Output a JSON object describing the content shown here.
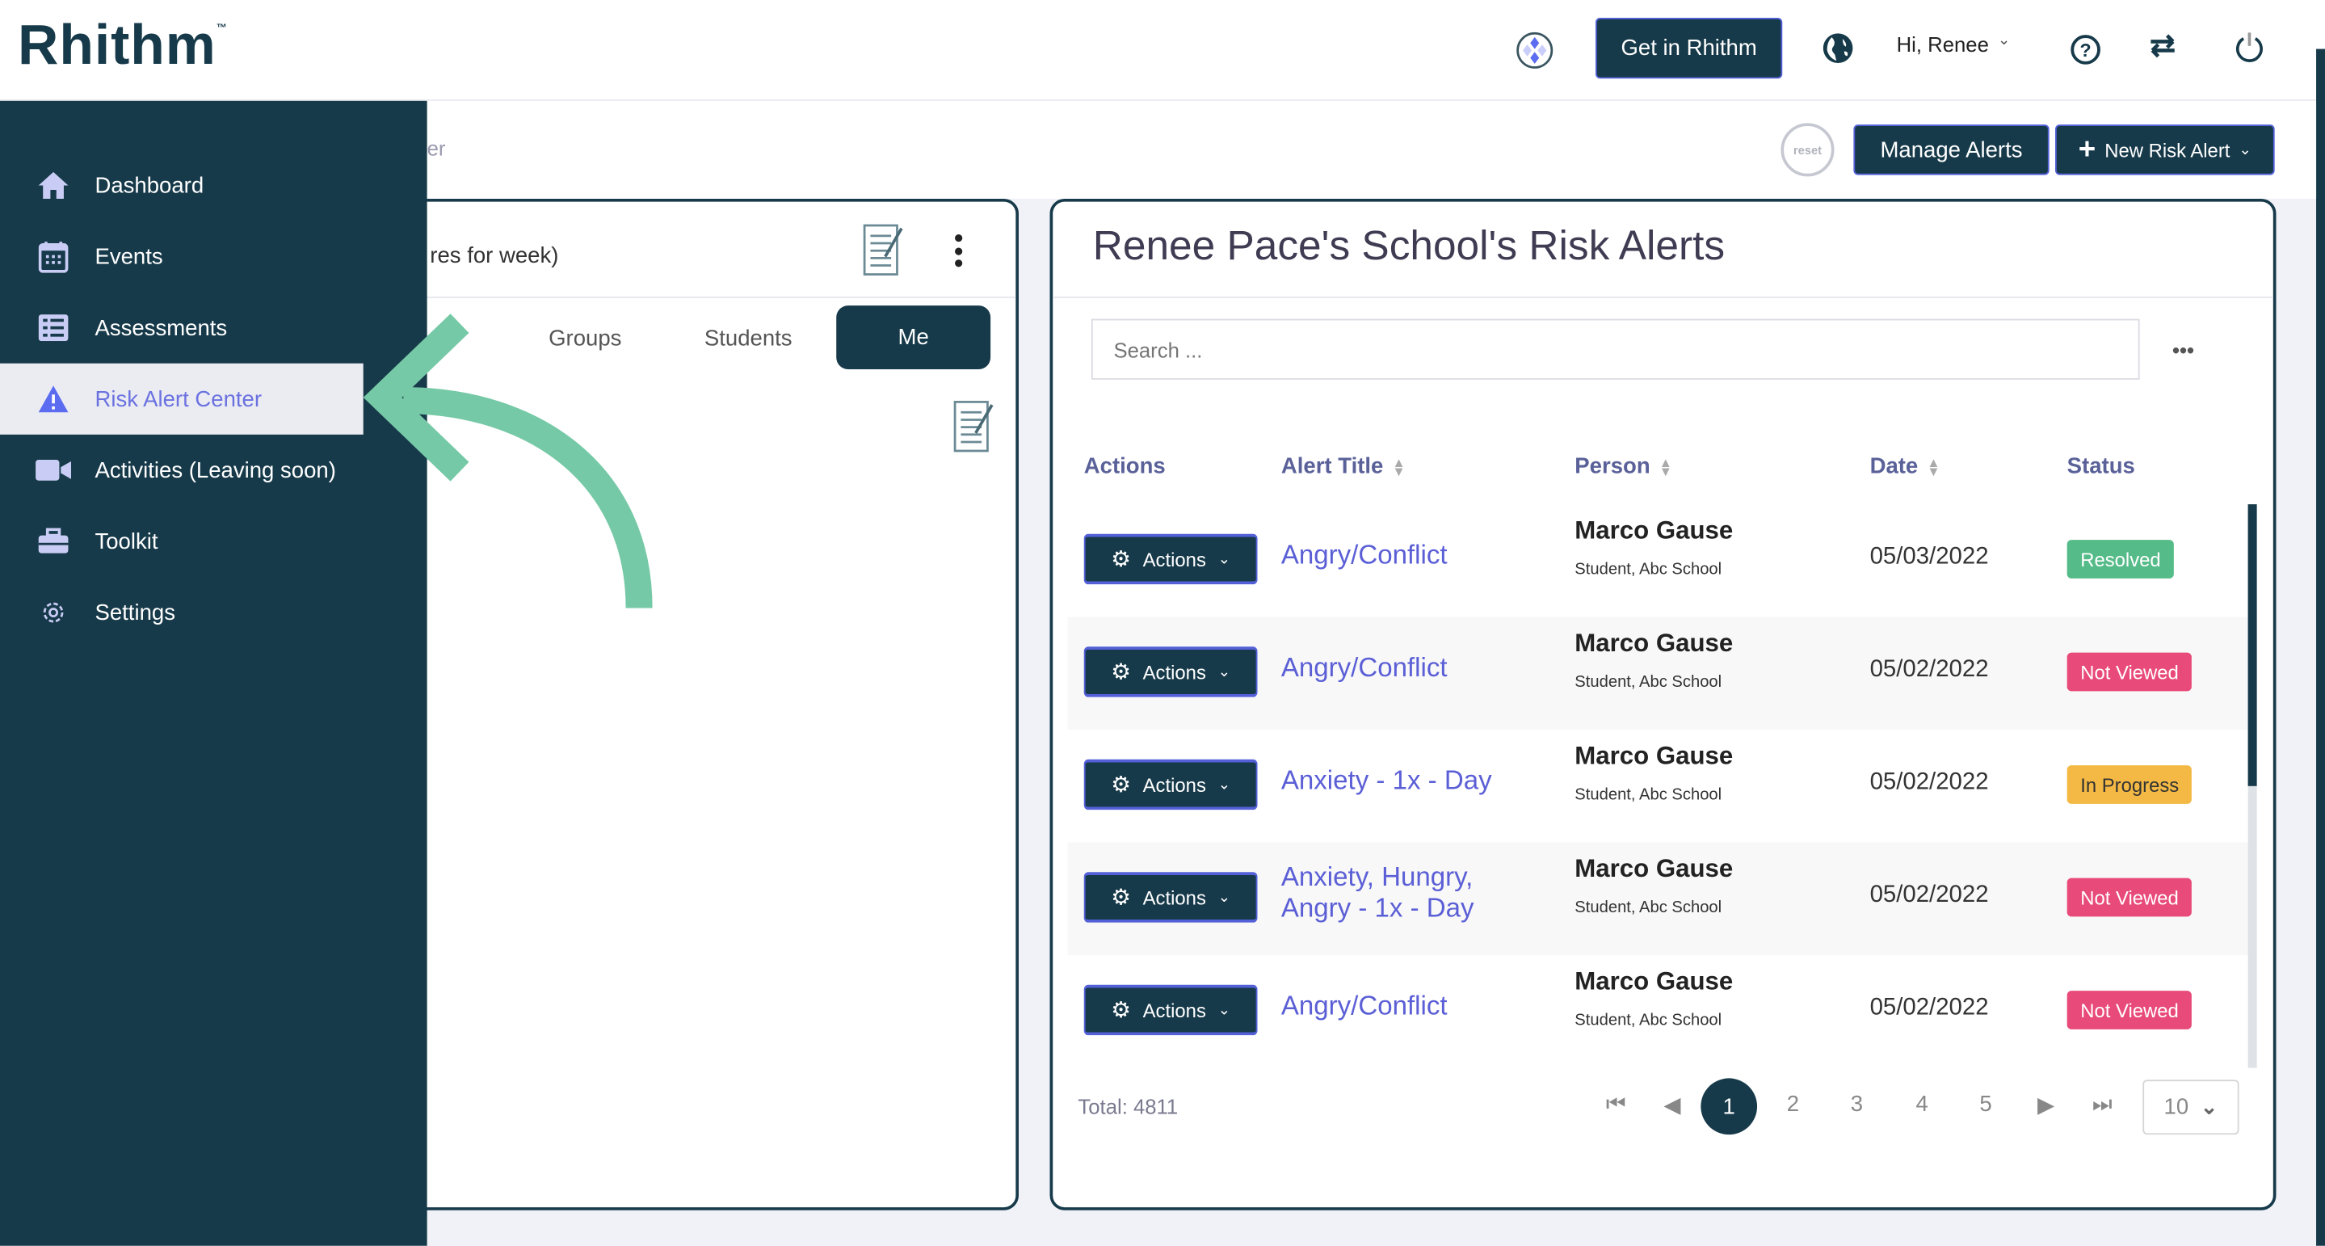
{
  "header": {
    "logo": "Rhithm",
    "logo_tm": "™",
    "get_in_button": "Get in Rhithm",
    "user_greeting": "Hi, Renee",
    "icons": [
      "rhithm-app-icon",
      "globe-icon",
      "help-icon",
      "switch-icon",
      "power-icon"
    ]
  },
  "subheader": {
    "breadcrumb_fragment": "er",
    "reset_label": "reset",
    "manage_alerts": "Manage Alerts",
    "new_risk_alert": "New Risk Alert"
  },
  "sidebar": {
    "items": [
      {
        "label": "Dashboard",
        "icon": "home-icon"
      },
      {
        "label": "Events",
        "icon": "calendar-icon"
      },
      {
        "label": "Assessments",
        "icon": "list-icon"
      },
      {
        "label": "Risk Alert Center",
        "icon": "warning-icon",
        "active": true
      },
      {
        "label": "Activities (Leaving soon)",
        "icon": "video-icon"
      },
      {
        "label": "Toolkit",
        "icon": "toolbox-icon"
      },
      {
        "label": "Settings",
        "icon": "gear-icon"
      }
    ]
  },
  "left_card": {
    "title_fragment": "res for week)",
    "tabs": [
      "Groups",
      "Students",
      "Me"
    ],
    "active_tab": "Me"
  },
  "alerts": {
    "title": "Renee Pace's School's Risk Alerts",
    "search_placeholder": "Search ...",
    "columns": [
      "Actions",
      "Alert Title",
      "Person",
      "Date",
      "Status"
    ],
    "actions_label": "Actions",
    "rows": [
      {
        "title": "Angry/Conflict",
        "person": "Marco Gause",
        "person_sub": "Student, Abc School",
        "date": "05/03/2022",
        "status": "Resolved"
      },
      {
        "title": "Angry/Conflict",
        "person": "Marco Gause",
        "person_sub": "Student, Abc School",
        "date": "05/02/2022",
        "status": "Not Viewed"
      },
      {
        "title": "Anxiety - 1x - Day",
        "person": "Marco Gause",
        "person_sub": "Student, Abc School",
        "date": "05/02/2022",
        "status": "In Progress"
      },
      {
        "title": "Anxiety, Hungry, Angry - 1x - Day",
        "person": "Marco Gause",
        "person_sub": "Student, Abc School",
        "date": "05/02/2022",
        "status": "Not Viewed"
      },
      {
        "title": "Angry/Conflict",
        "person": "Marco Gause",
        "person_sub": "Student, Abc School",
        "date": "05/02/2022",
        "status": "Not Viewed"
      }
    ],
    "status_colors": {
      "Resolved": "#55bb88",
      "Not Viewed": "#e84a7a",
      "In Progress": "#f3b944"
    },
    "total": "Total: 4811",
    "pages": [
      "1",
      "2",
      "3",
      "4",
      "5"
    ],
    "current_page": "1",
    "page_size": "10"
  },
  "colors": {
    "primary": "#173a4a",
    "accent": "#6b72e0",
    "arrow": "#76c9a6"
  }
}
